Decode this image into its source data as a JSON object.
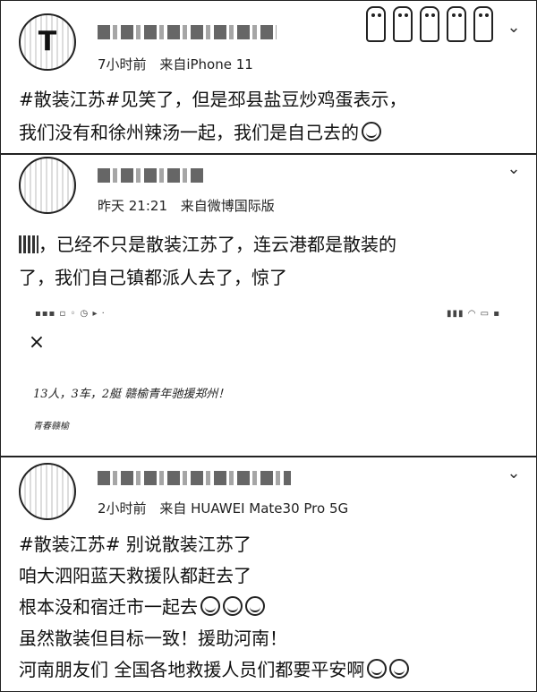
{
  "posts": [
    {
      "avatar_glyph": "T",
      "time": "7小时前",
      "source": "来自iPhone 11",
      "lines": [
        "#散装江苏#见笑了，但是邳县盐豆炒鸡蛋表示，",
        "我们没有和徐州辣汤一起，我们是自己去的"
      ],
      "emoji": "grin-emoji"
    },
    {
      "avatar_glyph": "",
      "time": "昨天 21:21",
      "source": "来自微博国际版",
      "lines": [
        "，已经不只是散装江苏了，连云港都是散装的",
        "了，我们自己镇都派人去了，惊了"
      ],
      "embedded_screenshot": {
        "close_symbol": "×",
        "handwriting_line1": "13人，3车，2艇 赣榆青年驰援郑州！",
        "handwriting_line2": "青春赣榆"
      }
    },
    {
      "avatar_glyph": "",
      "time": "2小时前",
      "source": "来自 HUAWEI Mate30 Pro 5G",
      "lines": [
        "#散装江苏# 别说散装江苏了",
        "咱大泗阳蓝天救援队都赶去了",
        "根本没和宿迁市一起去",
        "虽然散装但目标一致！援助河南！",
        "河南朋友们 全国各地救援人员们都要平安啊"
      ]
    }
  ],
  "icons": {
    "chevron": "chevron-down-icon",
    "close": "close-icon"
  }
}
